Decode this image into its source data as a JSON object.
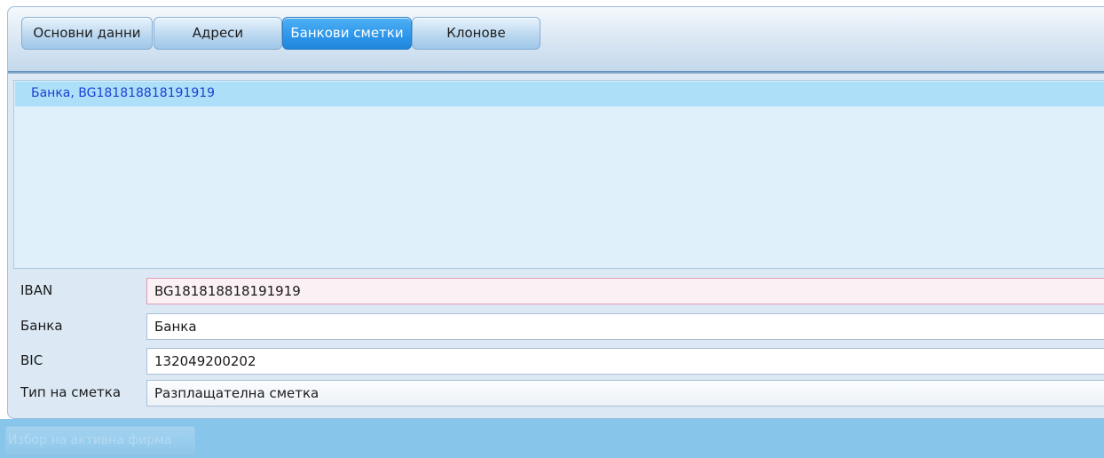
{
  "tabs": [
    {
      "label": "Основни данни",
      "active": false
    },
    {
      "label": "Адреси",
      "active": false
    },
    {
      "label": "Банкови сметки",
      "active": true
    },
    {
      "label": "Клонове",
      "active": false
    }
  ],
  "accounts_list": {
    "items": [
      {
        "label": "Банка, BG181818818191919",
        "selected": true
      }
    ]
  },
  "form": {
    "iban": {
      "label": "IBAN",
      "value": "BG181818818191919"
    },
    "bank": {
      "label": "Банка",
      "value": "Банка"
    },
    "bic": {
      "label": "BIC",
      "value": "132049200202"
    },
    "account_type": {
      "label": "Тип на сметка",
      "value": "Разплащателна сметка"
    }
  },
  "footer": {
    "activate_company_label": "Избор на активна фирма",
    "activate_company_enabled": false
  },
  "colors": {
    "active_tab": "#2d96ea",
    "selected_row": "#ade0f8",
    "selected_text": "#1a3fd4",
    "bottom_bar": "#88c5ea"
  }
}
